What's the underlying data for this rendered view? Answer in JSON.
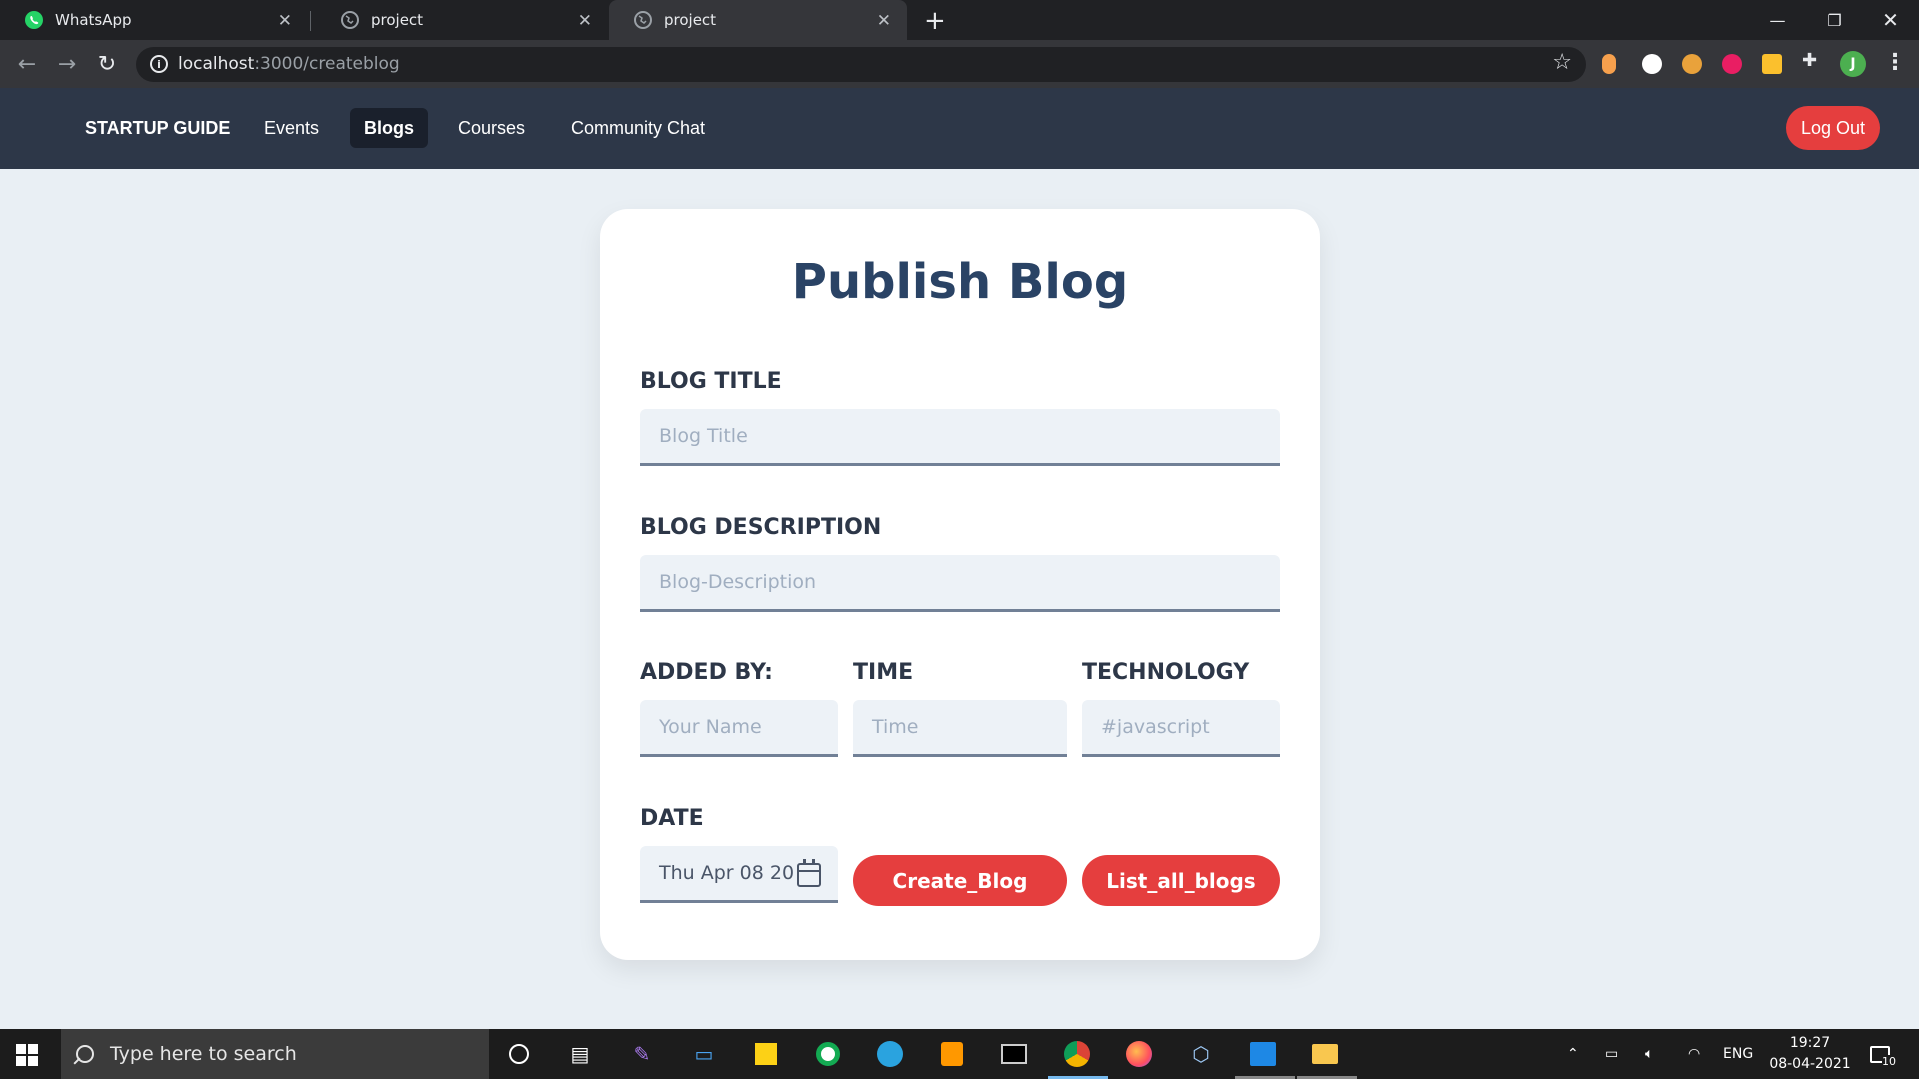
{
  "browser": {
    "tabs": [
      {
        "title": "WhatsApp",
        "active": false,
        "icon": "whatsapp-icon"
      },
      {
        "title": "project",
        "active": false,
        "icon": "globe-icon"
      },
      {
        "title": "project",
        "active": true,
        "icon": "globe-icon"
      }
    ],
    "url_host": "localhost",
    "url_path": ":3000/createblog",
    "profile_initial": "J"
  },
  "navbar": {
    "brand": "STARTUP GUIDE",
    "links": [
      "Events",
      "Blogs",
      "Courses",
      "Community Chat"
    ],
    "active": "Blogs",
    "logout_label": "Log Out"
  },
  "form": {
    "title": "Publish Blog",
    "blog_title_label": "BLOG TITLE",
    "blog_title_placeholder": "Blog Title",
    "blog_description_label": "BLOG DESCRIPTION",
    "blog_description_placeholder": "Blog-Description",
    "added_by_label": "ADDED BY:",
    "added_by_placeholder": "Your Name",
    "time_label": "TIME",
    "time_placeholder": "Time",
    "technology_label": "TECHNOLOGY",
    "technology_placeholder": "#javascript",
    "date_label": "DATE",
    "date_value": "Thu Apr 08 20",
    "create_button": "Create_Blog",
    "list_button": "List_all_blogs"
  },
  "colors": {
    "accent": "#e53e3e",
    "navbar_bg": "#2d3748",
    "title": "#2a4365",
    "page_bg": "#e9eff4"
  },
  "taskbar": {
    "search_placeholder": "Type here to search",
    "language": "ENG",
    "time": "19:27",
    "date": "08-04-2021",
    "notifications": "10"
  }
}
